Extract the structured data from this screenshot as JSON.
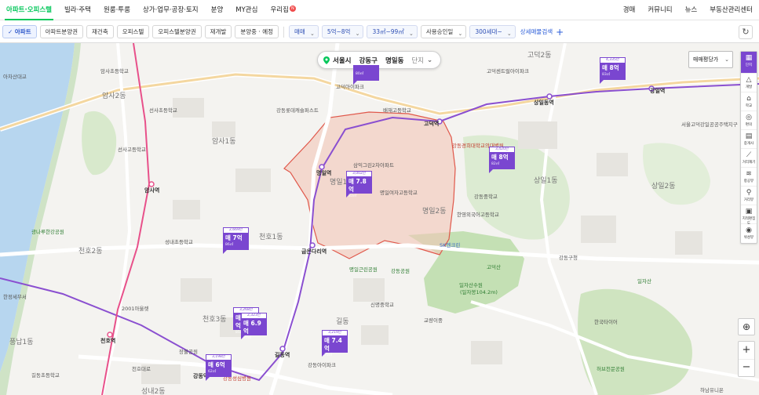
{
  "nav": {
    "tabs": [
      {
        "label": "아파트·오피스텔",
        "active": true
      },
      {
        "label": "빌라·주택"
      },
      {
        "label": "원룸·투룸"
      },
      {
        "label": "상가·업무·공장·토지"
      },
      {
        "label": "분양"
      },
      {
        "label": "MY관심"
      },
      {
        "label": "우리집",
        "badge": "N"
      }
    ],
    "right": [
      "경매",
      "커뮤니티",
      "뉴스",
      "부동산관리센터"
    ]
  },
  "filters": {
    "types": [
      {
        "label": "✓ 아파트",
        "active": true
      },
      {
        "label": "아파트분양권"
      },
      {
        "label": "재건축"
      },
      {
        "label": "오피스텔"
      },
      {
        "label": "오피스텔분양권"
      },
      {
        "label": "재개발"
      },
      {
        "label": "분양중 · 예정"
      }
    ],
    "selects": [
      {
        "label": "매매"
      },
      {
        "label": "5억~8억"
      },
      {
        "label": "33㎡~99㎡"
      },
      {
        "label": "사용승인일",
        "plain": true
      },
      {
        "label": "300세대~"
      }
    ],
    "detail_search": "상세매물검색",
    "add": "+"
  },
  "location": {
    "city": "서울시",
    "district": "강동구",
    "dong": "명일동",
    "dan": "단지"
  },
  "price_type": "매매평당가",
  "tools": [
    {
      "icon": "▦",
      "label": "단지",
      "active": true
    },
    {
      "icon": "△",
      "label": "개발"
    },
    {
      "icon": "⌂",
      "label": "학교"
    },
    {
      "icon": "◎",
      "label": "편의"
    },
    {
      "icon": "▤",
      "label": "중개사"
    },
    {
      "icon": "⟋",
      "label": "거리재기"
    },
    {
      "icon": "≋",
      "label": "항공뷰"
    },
    {
      "icon": "⚲",
      "label": "거리뷰"
    },
    {
      "icon": "▣",
      "label": "지적편집도"
    },
    {
      "icon": "◉",
      "label": "위성뷰"
    }
  ],
  "markers": [
    {
      "count": "",
      "price": "",
      "area": "80㎡"
    },
    {
      "count": "4,335만",
      "price": "매 8억",
      "area": "83㎡"
    },
    {
      "count": "3,002만",
      "price": "매 7.8억",
      "area": "83㎡"
    },
    {
      "count": "3,420만",
      "price": "매 8억",
      "area": "82㎡"
    },
    {
      "count": "2,669만",
      "price": "매 7억",
      "area": "86㎡"
    },
    {
      "count": "3,268만",
      "price": "매 6.9억",
      "area": "85㎡"
    },
    {
      "count": "2,323만",
      "price": "매 6.9억",
      "area": "97㎡"
    },
    {
      "count": "3,219만",
      "price": "매 7.4억",
      "area": "75㎡"
    },
    {
      "count": "3,198만",
      "price": "매 6억",
      "area": "62㎡"
    }
  ],
  "labels": {
    "dongs": [
      "암사2동",
      "암사1동",
      "명일1동",
      "명일2동",
      "상일1동",
      "상일2동",
      "천호1동",
      "천호2동",
      "천호3동",
      "길동",
      "성내2동",
      "풍납1동",
      "고덕2동"
    ],
    "stations": [
      "암사역",
      "명일역",
      "고덕역",
      "상일동역",
      "강일역",
      "굽은다리역",
      "길동역",
      "천호역",
      "강동역"
    ],
    "places": [
      "암사초등학교",
      "선사초등학교",
      "선사고등학교",
      "강동롯데캐슬퍼스트",
      "고덕아이파크",
      "배재고등학교",
      "삼익그린2차아파트",
      "명일여자고등학교",
      "한영외국어고등학교",
      "SK엔크린",
      "강동중학교",
      "강동경희대학교의대병원",
      "고덕센트럴아이파크",
      "강동구청",
      "일자산",
      "한국타이어",
      "허브천문공원",
      "2001아울렛",
      "성내초등학교",
      "강동성심병원",
      "신명중학교",
      "길동초등학교",
      "강동아이파크",
      "장불공원",
      "천호대로",
      "아차산대교",
      "광나루한강공원",
      "한정세무서",
      "서울고덕강일공공주택지구",
      "하남유니온"
    ],
    "misc": [
      "명일근린공원",
      "강동공원",
      "일자산수원",
      "(일자봉104.2m)",
      "고덕산",
      "교량이중"
    ]
  }
}
